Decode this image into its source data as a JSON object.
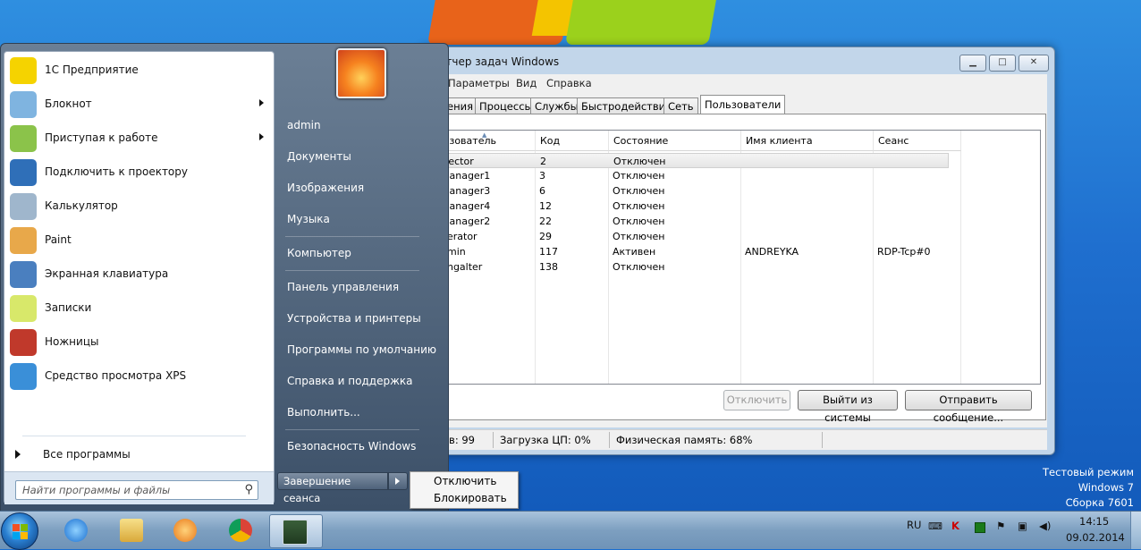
{
  "window": {
    "title": "етчер задач Windows",
    "menu": [
      "Параметры",
      "Вид",
      "Справка"
    ],
    "tabs": [
      "ения",
      "Процессы",
      "Службы",
      "Быстродействие",
      "Сеть",
      "Пользователи"
    ],
    "columns": [
      "ьзователь",
      "Код",
      "Состояние",
      "Имя клиента",
      "Сеанс"
    ],
    "rows": [
      {
        "user": "irector",
        "id": "2",
        "state": "Отключен",
        "client": "",
        "session": ""
      },
      {
        "user": "Manager1",
        "id": "3",
        "state": "Отключен",
        "client": "",
        "session": ""
      },
      {
        "user": "Manager3",
        "id": "6",
        "state": "Отключен",
        "client": "",
        "session": ""
      },
      {
        "user": "Manager4",
        "id": "12",
        "state": "Отключен",
        "client": "",
        "session": ""
      },
      {
        "user": "Manager2",
        "id": "22",
        "state": "Отключен",
        "client": "",
        "session": ""
      },
      {
        "user": "perator",
        "id": "29",
        "state": "Отключен",
        "client": "",
        "session": ""
      },
      {
        "user": "dmin",
        "id": "117",
        "state": "Активен",
        "client": "ANDREYKA",
        "session": "RDP-Tcp#0"
      },
      {
        "user": "uhgalter",
        "id": "138",
        "state": "Отключен",
        "client": "",
        "session": ""
      }
    ],
    "buttons": {
      "disconnect": "Отключить",
      "logoff": "Выйти из системы",
      "send": "Отправить сообщение..."
    },
    "status": {
      "processes": "ов: 99",
      "cpu": "Загрузка ЦП: 0%",
      "memory": "Физическая память: 68%"
    }
  },
  "start_menu": {
    "programs": [
      {
        "label": "1С Предприятие",
        "icon": "1c-icon",
        "color": "#f5d300"
      },
      {
        "label": "Блокнот",
        "icon": "notepad-icon",
        "color": "#7fb4e0"
      },
      {
        "label": "Приступая к работе",
        "icon": "getting-started-icon",
        "color": "#8bc34a"
      },
      {
        "label": "Подключить к проектору",
        "icon": "projector-icon",
        "color": "#2f6fb8"
      },
      {
        "label": "Калькулятор",
        "icon": "calculator-icon",
        "color": "#9fb6cc"
      },
      {
        "label": "Paint",
        "icon": "paint-icon",
        "color": "#e8a84a"
      },
      {
        "label": "Экранная клавиатура",
        "icon": "keyboard-icon",
        "color": "#4a7fbf"
      },
      {
        "label": "Записки",
        "icon": "sticky-notes-icon",
        "color": "#d8e86a"
      },
      {
        "label": "Ножницы",
        "icon": "scissors-icon",
        "color": "#c0392b"
      },
      {
        "label": "Средство просмотра XPS",
        "icon": "xps-viewer-icon",
        "color": "#3a8fd8"
      }
    ],
    "all_programs": "Все программы",
    "search_placeholder": "Найти программы и файлы",
    "user": "admin",
    "links": [
      "Документы",
      "Изображения",
      "Музыка",
      "Компьютер",
      "Панель управления",
      "Устройства и принтеры",
      "Программы по умолчанию",
      "Справка и поддержка",
      "Выполнить...",
      "Безопасность Windows"
    ],
    "shutdown_label": "Завершение сеанса",
    "shutdown_menu": [
      "Отключить",
      "Блокировать"
    ]
  },
  "taskbar": {
    "lang": "RU",
    "time": "14:15",
    "date": "09.02.2014",
    "pinned": [
      "ie-icon",
      "explorer-icon",
      "media-player-icon",
      "chrome-icon",
      "task-manager-icon"
    ]
  },
  "watermark": [
    "Тестовый режим",
    "Windows 7",
    "Сборка 7601"
  ]
}
